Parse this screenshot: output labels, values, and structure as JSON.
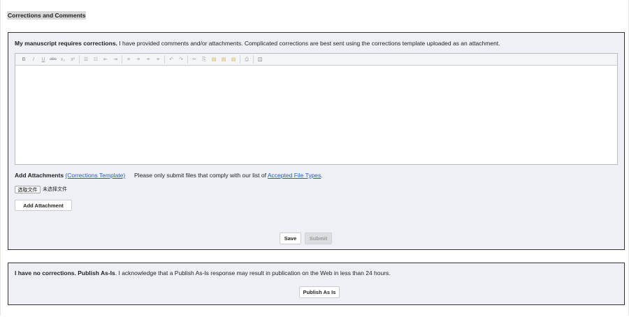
{
  "section_title": "Corrections and Comments",
  "corrections": {
    "heading_bold": "My manuscript requires corrections.",
    "heading_rest": " I have provided comments and/or attachments. Complicated corrections are best sent using the corrections template uploaded as an attachment.",
    "toolbar": {
      "bold": "B",
      "italic": "I",
      "underline": "U",
      "strike": "abc",
      "subscript": "x₂",
      "superscript": "x²",
      "bullet_list": "☰",
      "numbered_list": "☷",
      "outdent": "⇤",
      "indent": "⇥",
      "align_left": "≡",
      "align_center": "≡",
      "align_right": "≡",
      "justify": "≡",
      "undo": "↶",
      "redo": "↷",
      "cut": "✂",
      "copy": "⎘",
      "paste": "▤",
      "paste_text": "▤",
      "paste_word": "▤",
      "print": "⎙",
      "source": "◫"
    },
    "attachments_label": "Add Attachments",
    "template_link": "(Corrections Template)",
    "file_types_text": "Please only submit files that comply with our list of",
    "file_types_link": "Accepted File Types",
    "file_types_period": ".",
    "choose_file_label": "选取文件",
    "no_file_text": "未选择文件",
    "add_attachment_button": "Add Attachment",
    "save_button": "Save",
    "submit_button": "Submit"
  },
  "publish": {
    "heading_bold": "I have no corrections. Publish As-Is",
    "heading_rest": ". I acknowledge that a Publish As-Is response may result in publication on the Web in less than 24 hours.",
    "publish_button": "Publish As Is"
  }
}
